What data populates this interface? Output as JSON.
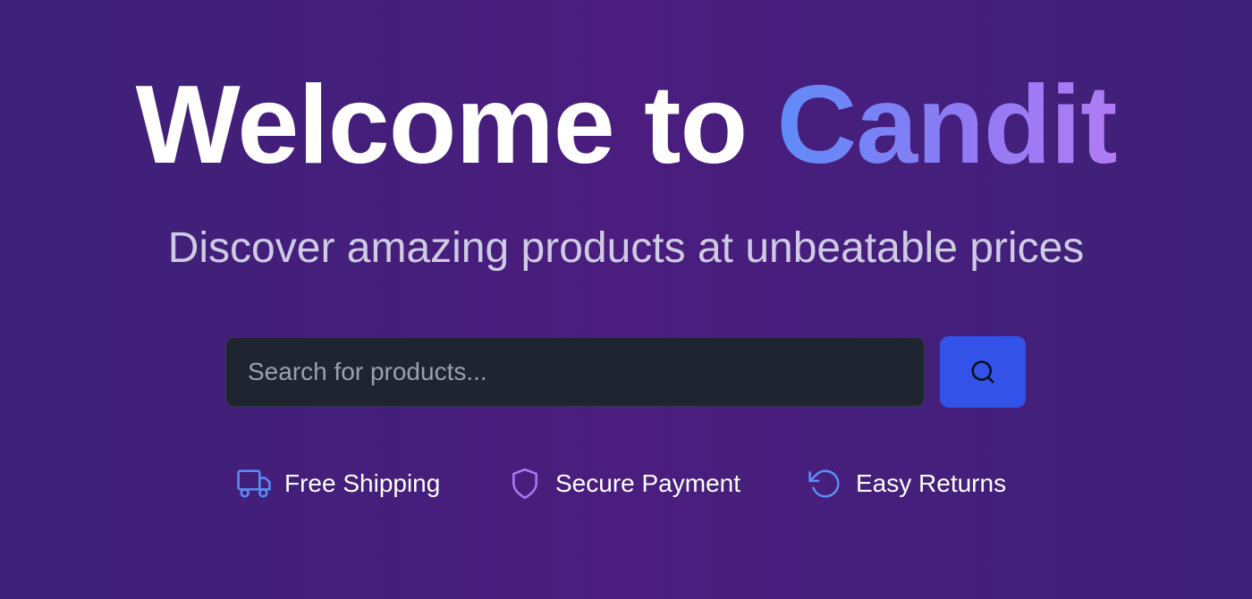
{
  "hero": {
    "title_prefix": "Welcome to ",
    "title_brand": "Candit",
    "subtitle": "Discover amazing products at unbeatable prices"
  },
  "search": {
    "placeholder": "Search for products...",
    "value": "",
    "button_icon": "search-icon"
  },
  "features": [
    {
      "label": "Free Shipping",
      "icon": "truck-icon",
      "color": "#5b8df6"
    },
    {
      "label": "Secure Payment",
      "icon": "shield-icon",
      "color": "#a67af4"
    },
    {
      "label": "Easy Returns",
      "icon": "rotate-ccw-icon",
      "color": "#5b8df6"
    }
  ],
  "colors": {
    "background_start": "#3d2178",
    "background_mid": "#4a1d7e",
    "brand_gradient_start": "#5f8cf7",
    "brand_gradient_end": "#b07cf4",
    "subtitle": "#cfcbe3",
    "search_field_bg": "#1f2530",
    "search_button_bg": "#3352e7"
  }
}
